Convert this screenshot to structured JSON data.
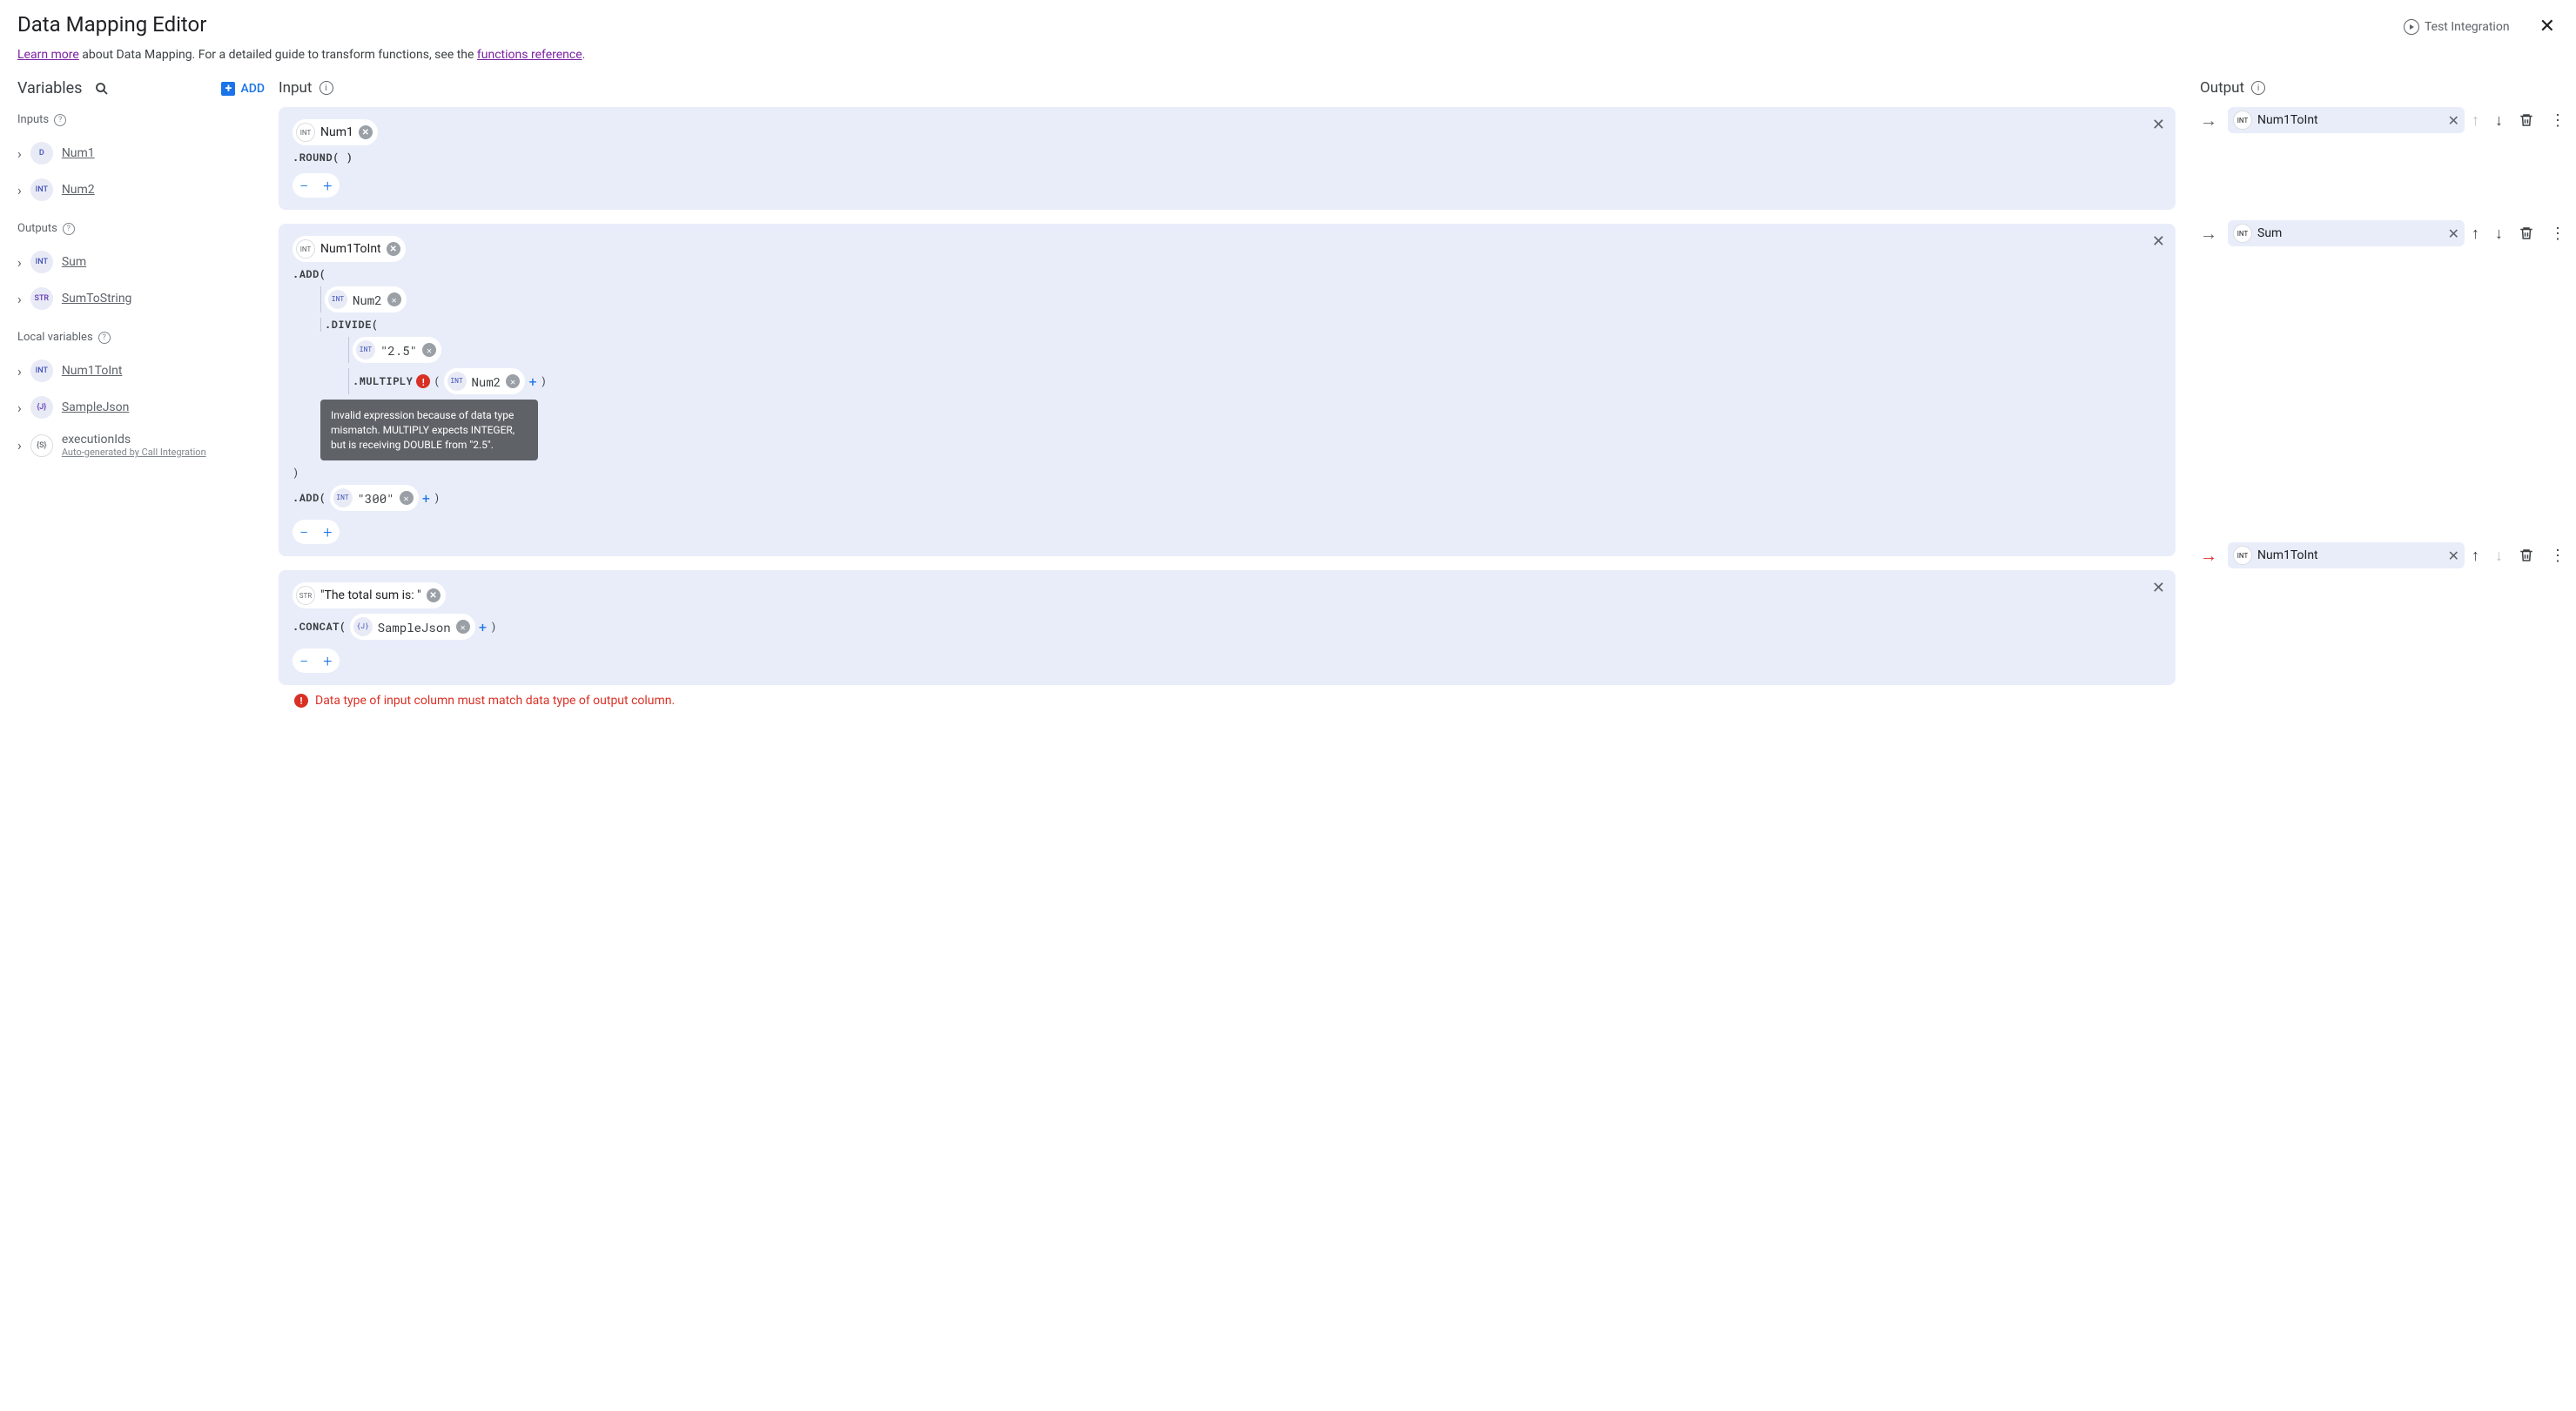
{
  "header": {
    "title": "Data Mapping Editor",
    "test_label": "Test Integration"
  },
  "subheader": {
    "learn_more": "Learn more",
    "mid_text": " about Data Mapping. For a detailed guide to transform functions, see the ",
    "func_ref": "functions reference",
    "period": "."
  },
  "left": {
    "variables_title": "Variables",
    "add_label": "ADD",
    "inputs_label": "Inputs",
    "outputs_label": "Outputs",
    "locals_label": "Local variables",
    "inputs": [
      {
        "name": "Num1",
        "badge": "D"
      },
      {
        "name": "Num2",
        "badge": "INT"
      }
    ],
    "outputs": [
      {
        "name": "Sum",
        "badge": "INT"
      },
      {
        "name": "SumToString",
        "badge": "STR"
      }
    ],
    "locals": [
      {
        "name": "Num1ToInt",
        "badge": "INT",
        "sub": ""
      },
      {
        "name": "SampleJson",
        "badge": "{J}",
        "sub": ""
      },
      {
        "name": "executionIds",
        "badge": "{S}",
        "sub": "Auto-generated by Call Integration"
      }
    ]
  },
  "columns": {
    "input_title": "Input",
    "output_title": "Output"
  },
  "rows": [
    {
      "input": {
        "chip_badge": "INT",
        "chip_text": "Num1",
        "func1": ".ROUND( )"
      },
      "output": {
        "badge": "INT",
        "text": "Num1ToInt",
        "up_disabled": true,
        "down_disabled": false
      }
    },
    {
      "input": {
        "chip_badge": "INT",
        "chip_text": "Num1ToInt",
        "add_label": ".ADD(",
        "num2_badge": "INT",
        "num2_text": "Num2",
        "divide_label": ".DIVIDE(",
        "lit_badge": "INT",
        "lit_text": "\"2.5\"",
        "multiply_label": ".MULTIPLY",
        "mult_arg_badge": "INT",
        "mult_arg_text": "Num2",
        "close": ")",
        "tooltip": "Invalid expression because of data type mismatch. MULTIPLY expects INTEGER, but is receiving DOUBLE from \"2.5\".",
        "add2_label": ".ADD(",
        "add2_badge": "INT",
        "add2_text": "\"300\""
      },
      "output": {
        "badge": "INT",
        "text": "Sum",
        "up_disabled": false,
        "down_disabled": false
      }
    },
    {
      "input": {
        "chip_badge": "STR",
        "chip_text": "\"The total sum is: \"",
        "concat_label": ".CONCAT(",
        "concat_badge": "{J}",
        "concat_arg": "SampleJson",
        "close": ")"
      },
      "output": {
        "badge": "INT",
        "text": "Num1ToInt",
        "up_disabled": false,
        "down_disabled": true,
        "error": true
      }
    }
  ],
  "error_msg": "Data type of input column must match data type of output column."
}
